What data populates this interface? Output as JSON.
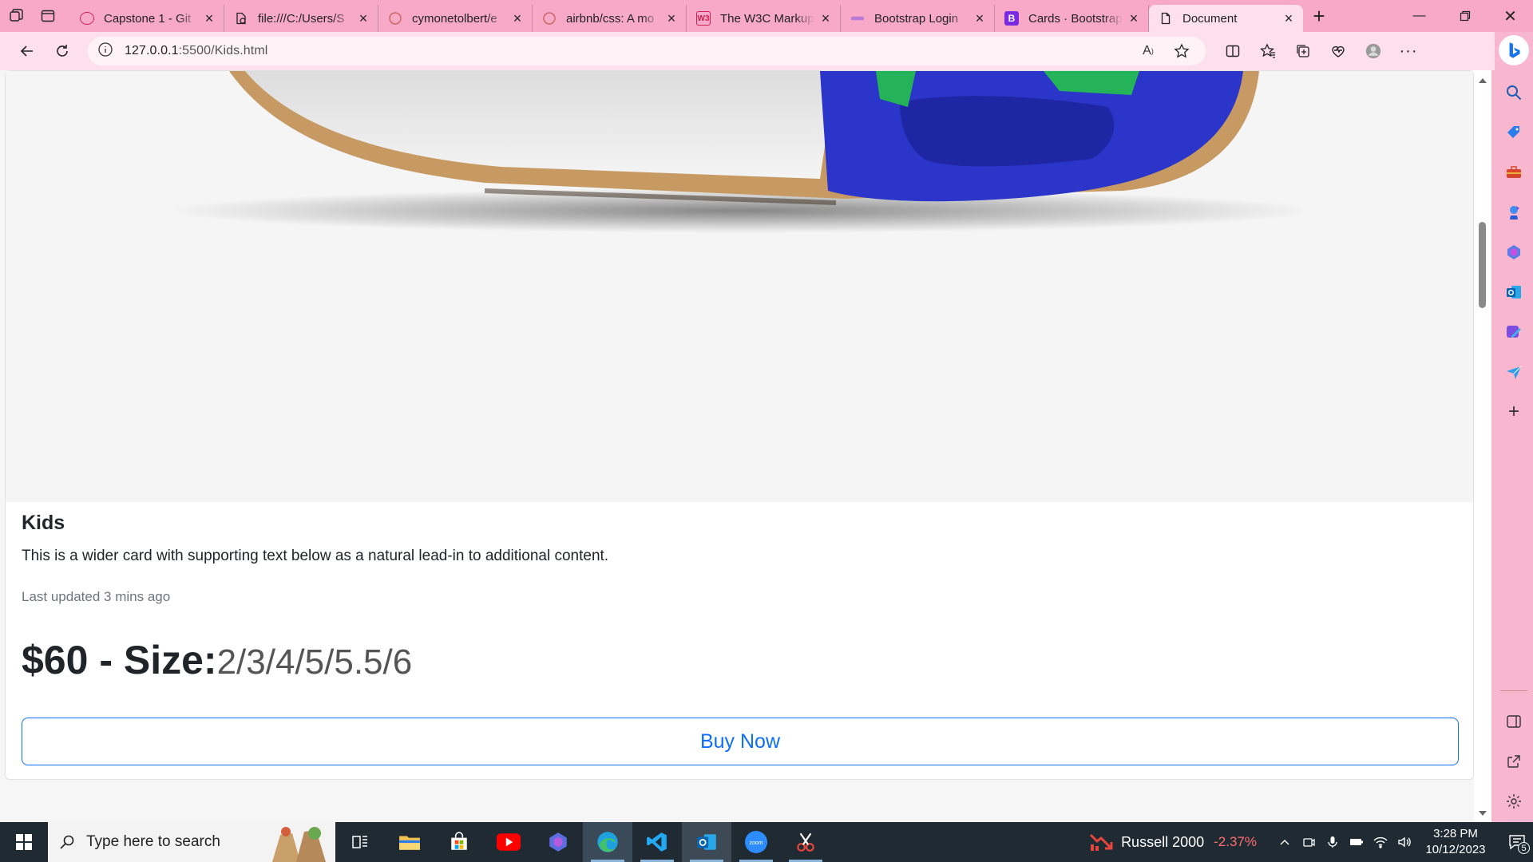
{
  "browser": {
    "tabs": [
      {
        "title": "Capstone 1 - Git",
        "favicon": "capstone-favicon",
        "active": false
      },
      {
        "title": "file:///C:/Users/S",
        "favicon": "file-favicon",
        "active": false
      },
      {
        "title": "cymonetolbert/e",
        "favicon": "github-favicon",
        "active": false
      },
      {
        "title": "airbnb/css: A mo",
        "favicon": "github-favicon",
        "active": false
      },
      {
        "title": "The W3C Markup",
        "favicon": "w3c-favicon",
        "active": false
      },
      {
        "title": "Bootstrap Login",
        "favicon": "bootstrap-favicon",
        "active": false
      },
      {
        "title": "Cards · Bootstrap",
        "favicon": "bootstrap-favicon",
        "active": false
      },
      {
        "title": "Document",
        "favicon": "document-favicon",
        "active": true
      }
    ],
    "w3c_favicon_text": "W3",
    "bootstrap_favicon_text": "B",
    "address": {
      "host": "127.0.0.1",
      "path": ":5500/Kids.html"
    },
    "colors": {
      "frame": "#f7a9c7",
      "toolbar": "#fde0ec",
      "accent": "#0d6efd"
    }
  },
  "page": {
    "card": {
      "title": "Kids",
      "text": "This is a wider card with supporting text below as a natural lead-in to additional content.",
      "muted": "Last updated 3 mins ago",
      "price": "$60 - Size:",
      "sizes": "2/3/4/5/5.5/6",
      "button": "Buy Now"
    }
  },
  "taskbar": {
    "search_placeholder": "Type here to search",
    "stock": {
      "name": "Russell 2000",
      "change": "-2.37%"
    },
    "time": "3:28 PM",
    "date": "10/12/2023",
    "notifications": "5",
    "apps": [
      "task-view",
      "file-explorer",
      "microsoft-store",
      "youtube",
      "copilot",
      "edge",
      "vscode",
      "outlook",
      "zoom",
      "snipping-tool"
    ],
    "zoom_label": "zoom"
  }
}
